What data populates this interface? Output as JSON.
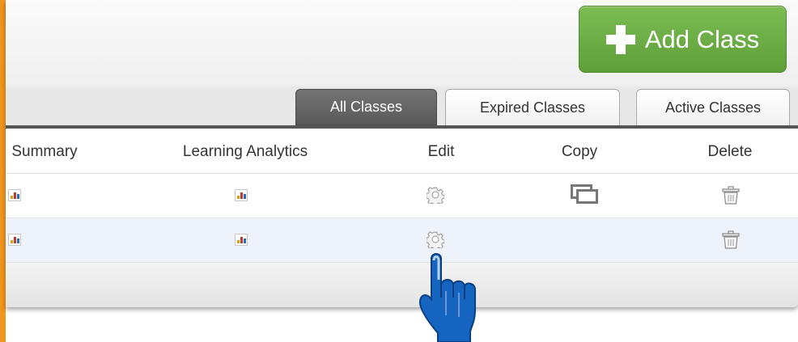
{
  "toolbar": {
    "add_class_label": "Add Class"
  },
  "tabs": [
    {
      "label": "All Classes",
      "active": true
    },
    {
      "label": "Expired Classes",
      "active": false
    },
    {
      "label": "Active Classes",
      "active": false
    }
  ],
  "table": {
    "columns": [
      "Summary",
      "Learning Analytics",
      "Edit",
      "Copy",
      "Delete"
    ],
    "rows": [
      {
        "summary": "chart-icon",
        "learning_analytics": "chart-icon",
        "edit": "gear-icon",
        "copy": "copy-icon",
        "delete": "trash-icon",
        "highlighted": false
      },
      {
        "summary": "chart-icon",
        "learning_analytics": "chart-icon",
        "edit": "gear-icon",
        "copy": null,
        "delete": "trash-icon",
        "highlighted": true
      }
    ]
  },
  "colors": {
    "accent": "#f0951e",
    "add_button": "#6fae47",
    "active_tab": "#656565",
    "row_highlight": "#edf2fb",
    "pointer_hand": "#1565c0"
  }
}
